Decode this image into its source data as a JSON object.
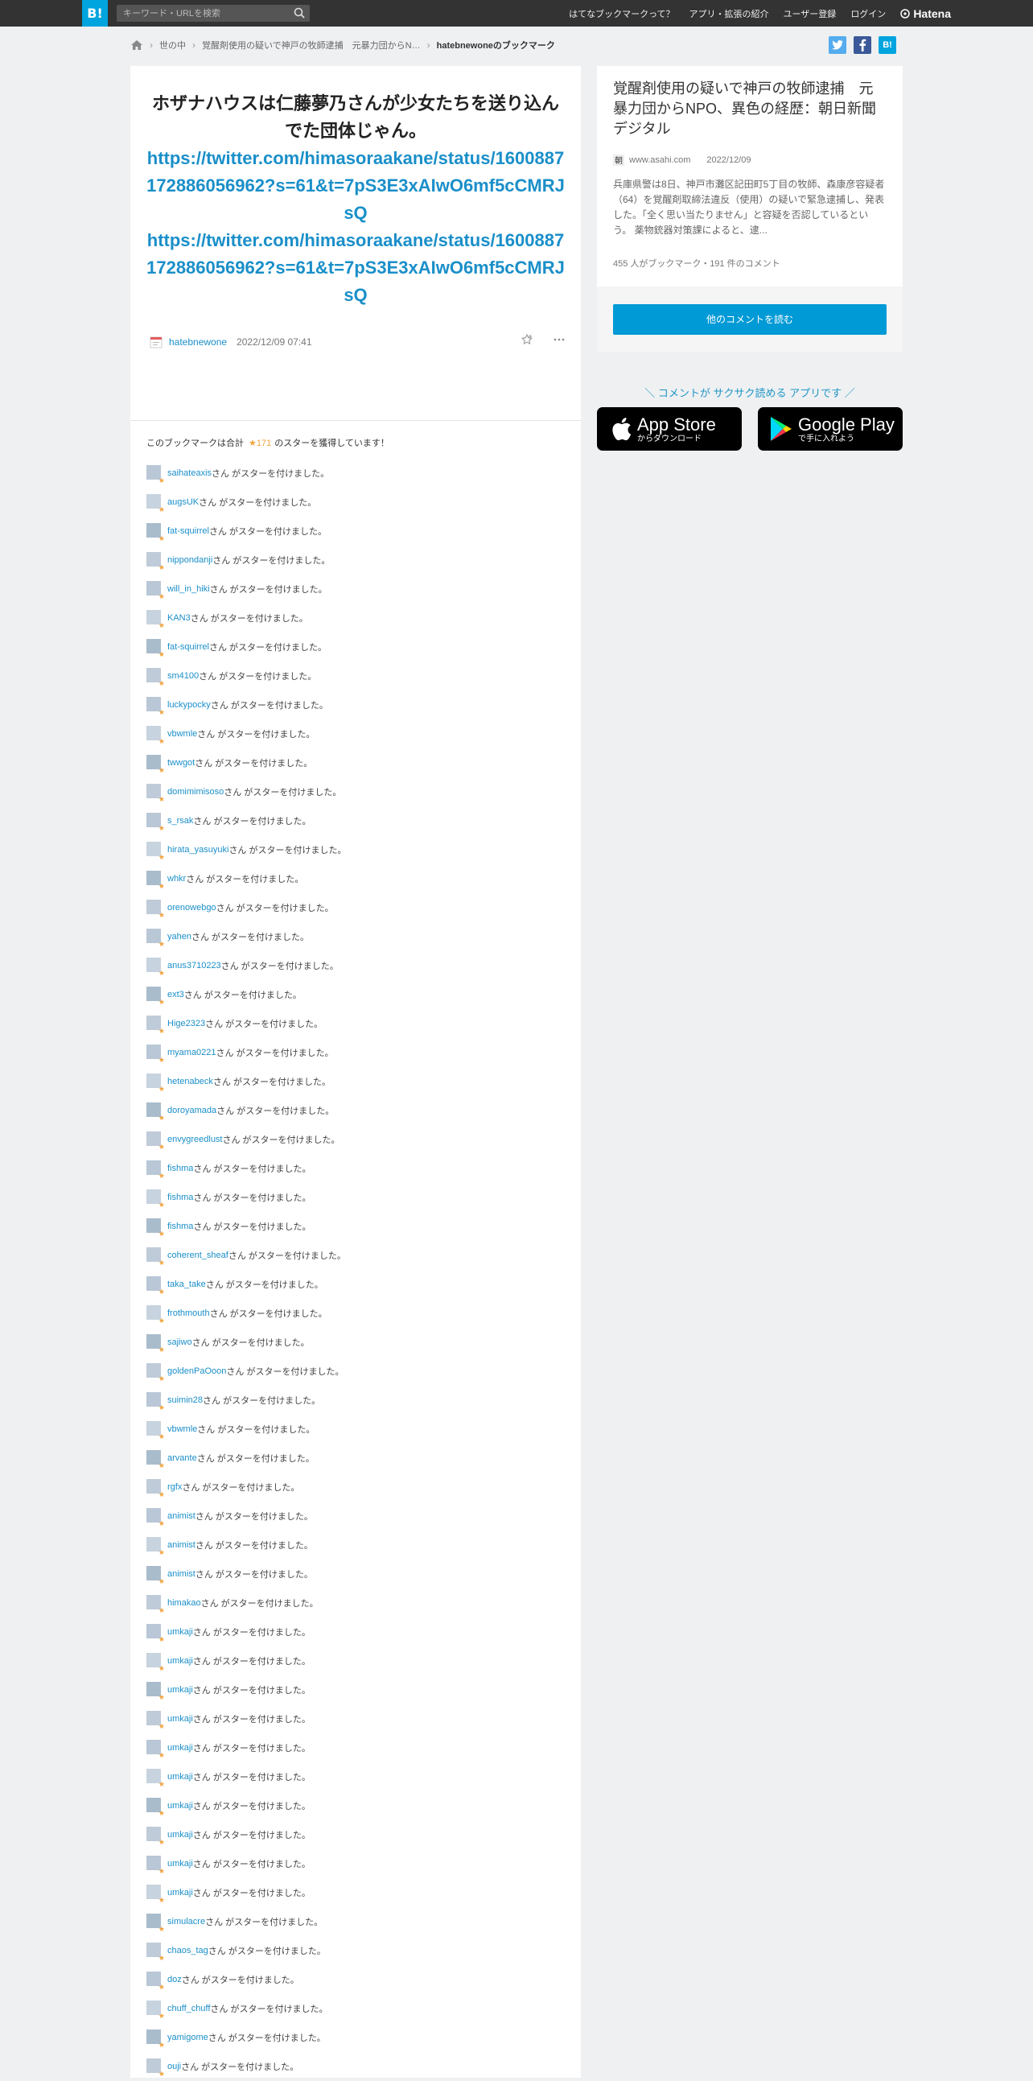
{
  "header": {
    "logo": "B!",
    "search_placeholder": "キーワード・URLを検索",
    "nav": [
      "はてなブックマークって？",
      "アプリ・拡張の紹介",
      "ユーザー登録",
      "ログイン"
    ],
    "brand": "Hatena"
  },
  "breadcrumb": {
    "items": [
      "世の中",
      "覚醒剤使用の疑いで神戸の牧師逮捕　元暴力団からN…",
      "hatebnewoneのブックマーク"
    ]
  },
  "share": {
    "twitter": "t",
    "facebook": "f",
    "hatena": "B!"
  },
  "bookmark": {
    "comment": "ホザナハウスは仁藤夢乃さんが少女たちを送り込んでた団体じゃん。",
    "urls": [
      "https://twitter.com/himasoraakane/status/1600887172886056962?s=61&t=7pS3E3xAIwO6mf5cCMRJsQ",
      "https://twitter.com/himasoraakane/status/1600887172886056962?s=61&t=7pS3E3xAIwO6mf5cCMRJsQ"
    ],
    "user": "hatebnewone",
    "date": "2022/12/09 07:41"
  },
  "stars": {
    "summary_prefix": "このブックマークは合計",
    "count": "★171",
    "summary_suffix": "のスターを獲得しています！",
    "suffix": "さん がスターを付けました。",
    "users": [
      "saihateaxis",
      "augsUK",
      "fat-squirrel",
      "nippondanji",
      "will_in_hiki",
      "KAN3",
      "fat-squirrel",
      "sm4100",
      "luckypocky",
      "vbwmle",
      "twwgot",
      "domimimisoso",
      "s_rsak",
      "hirata_yasuyuki",
      "whkr",
      "orenowebgo",
      "yahen",
      "anus3710223",
      "ext3",
      "Hige2323",
      "myama0221",
      "hetenabeck",
      "doroyamada",
      "envygreedlust",
      "fishma",
      "fishma",
      "fishma",
      "coherent_sheaf",
      "taka_take",
      "frothmouth",
      "sajiwo",
      "goldenPaOoon",
      "suimin28",
      "vbwmle",
      "arvante",
      "rgfx",
      "animist",
      "animist",
      "animist",
      "himakao",
      "umkaji",
      "umkaji",
      "umkaji",
      "umkaji",
      "umkaji",
      "umkaji",
      "umkaji",
      "umkaji",
      "umkaji",
      "umkaji",
      "simulacre",
      "chaos_tag",
      "doz",
      "chuff_chuff",
      "yamigome",
      "ouji"
    ]
  },
  "entry": {
    "title": "覚醒剤使用の疑いで神戸の牧師逮捕　元暴力団からNPO、異色の経歴：朝日新聞デジタル",
    "domain": "www.asahi.com",
    "date": "2022/12/09",
    "description": "兵庫県警は8日、神戸市灘区記田町5丁目の牧師、森康彦容疑者（64）を覚醒剤取締法違反（使用）の疑いで緊急逮捕し、発表した。「全く思い当たりません」と容疑を否認しているという。 薬物銃器対策課によると、逮...",
    "counts": "455 人がブックマーク・191 件のコメント",
    "read_button": "他のコメントを読む"
  },
  "app": {
    "banner": "＼ コメントが サクサク読める アプリです ／",
    "appstore_small": "からダウンロード",
    "appstore_big": "App Store",
    "googleplay_big": "Google Play",
    "googleplay_small": "で手に入れよう"
  },
  "colors": {
    "accent": "#00a4de",
    "link": "#1a8fc9",
    "star": "#f2a33c",
    "topbar": "#333333"
  }
}
